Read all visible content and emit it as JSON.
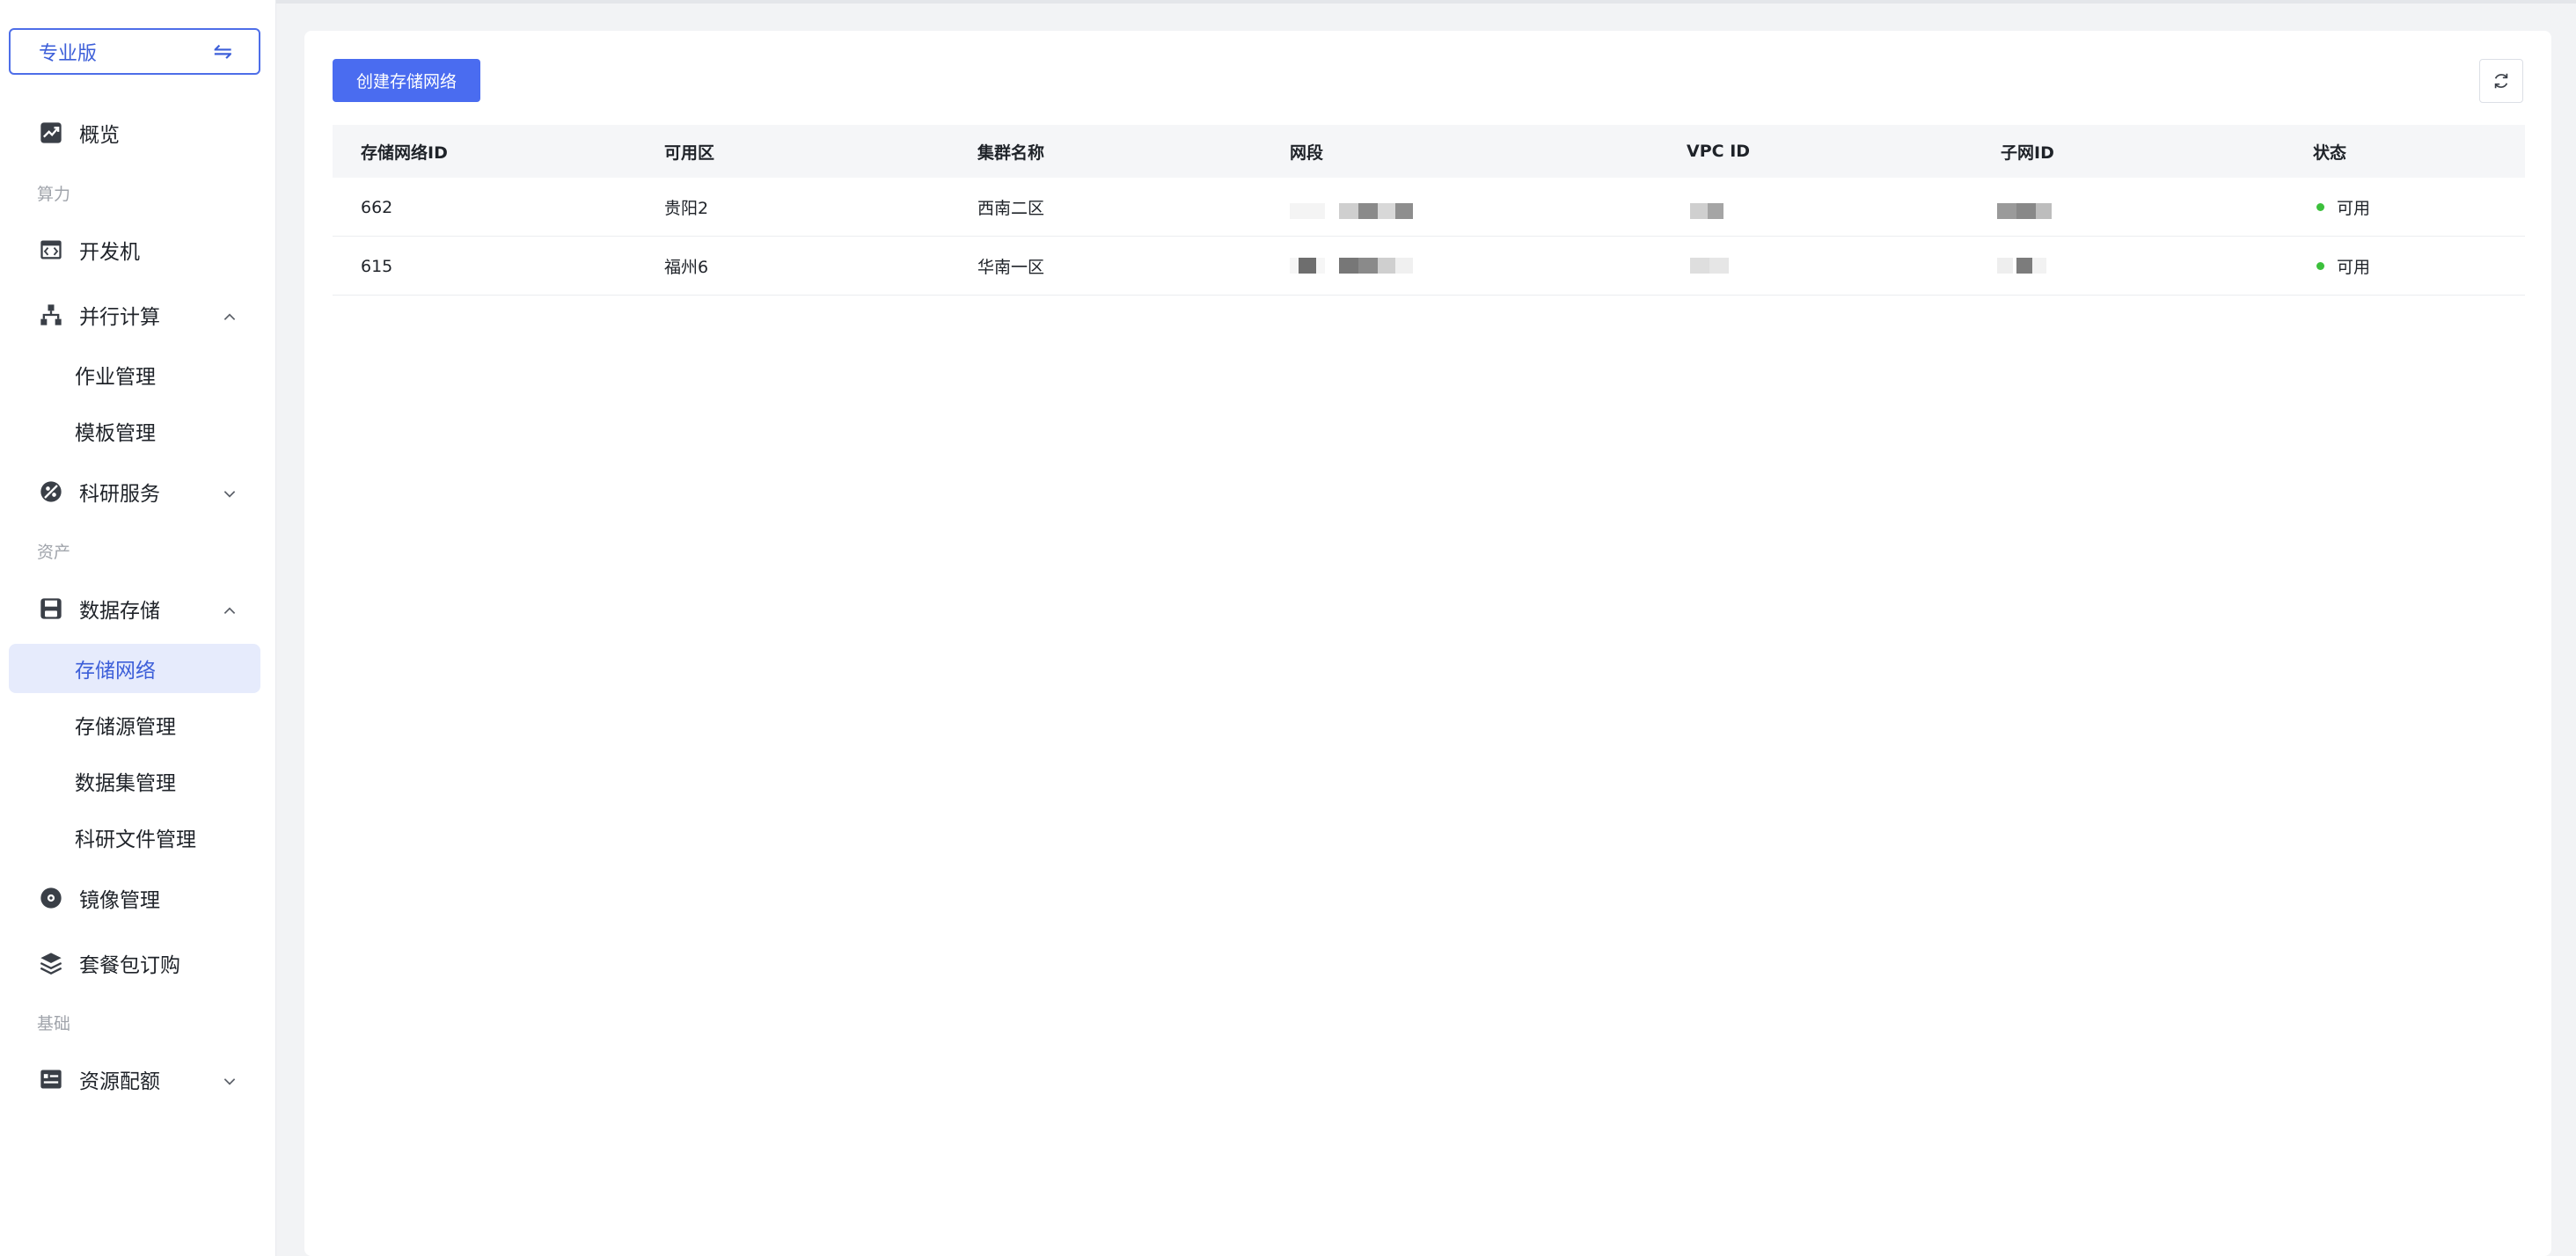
{
  "sidebar": {
    "edition": {
      "label": "专业版",
      "swap_icon": "⇋"
    },
    "overview": "概览",
    "groups": {
      "compute": "算力",
      "assets": "资产",
      "basic": "基础"
    },
    "devbox": "开发机",
    "parallel": {
      "label": "并行计算",
      "children": [
        "作业管理",
        "模板管理"
      ]
    },
    "research": "科研服务",
    "storage": {
      "label": "数据存储",
      "children": [
        "存储网络",
        "存储源管理",
        "数据集管理",
        "科研文件管理"
      ]
    },
    "image": "镜像管理",
    "package": "套餐包订购",
    "quota": "资源配额"
  },
  "toolbar": {
    "create_label": "创建存储网络"
  },
  "table": {
    "columns": [
      "存储网络ID",
      "可用区",
      "集群名称",
      "网段",
      "VPC ID",
      "子网ID",
      "状态"
    ],
    "rows": [
      {
        "id": "662",
        "zone": "贵阳2",
        "cluster": "西南二区",
        "status": "可用"
      },
      {
        "id": "615",
        "zone": "福州6",
        "cluster": "华南一区",
        "status": "可用"
      }
    ]
  },
  "colors": {
    "primary": "#4a6cf0",
    "active_bg": "#e6ebfc",
    "status_ok": "#3cc03c"
  }
}
